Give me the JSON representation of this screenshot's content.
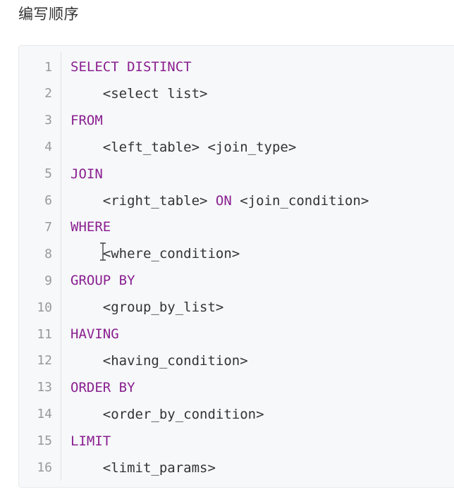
{
  "heading": "编写顺序",
  "colors": {
    "keyword": "#8a1f8f",
    "text": "#333333",
    "line_number": "#999999",
    "code_background": "#f6f8fa"
  },
  "lines": [
    {
      "n": "1",
      "indent": "",
      "kw": "SELECT DISTINCT",
      "txt": ""
    },
    {
      "n": "2",
      "indent": "    ",
      "kw": "",
      "txt": "<select list>"
    },
    {
      "n": "3",
      "indent": "",
      "kw": "FROM",
      "txt": ""
    },
    {
      "n": "4",
      "indent": "    ",
      "kw": "",
      "txt": "<left_table> <join_type>"
    },
    {
      "n": "5",
      "indent": "",
      "kw": "JOIN",
      "txt": ""
    },
    {
      "n": "6",
      "indent": "    ",
      "kw": "",
      "txt": "<right_table> ",
      "kw2": "ON",
      "txt2": " <join_condition>"
    },
    {
      "n": "7",
      "indent": "",
      "kw": "WHERE",
      "txt": ""
    },
    {
      "n": "8",
      "indent": "    ",
      "kw": "",
      "txt": "<where_condition>"
    },
    {
      "n": "9",
      "indent": "",
      "kw": "GROUP BY",
      "txt": ""
    },
    {
      "n": "10",
      "indent": "    ",
      "kw": "",
      "txt": "<group_by_list>"
    },
    {
      "n": "11",
      "indent": "",
      "kw": "HAVING",
      "txt": ""
    },
    {
      "n": "12",
      "indent": "    ",
      "kw": "",
      "txt": "<having_condition>"
    },
    {
      "n": "13",
      "indent": "",
      "kw": "ORDER BY",
      "txt": ""
    },
    {
      "n": "14",
      "indent": "    ",
      "kw": "",
      "txt": "<order_by_condition>"
    },
    {
      "n": "15",
      "indent": "",
      "kw": "LIMIT",
      "txt": ""
    },
    {
      "n": "16",
      "indent": "    ",
      "kw": "",
      "txt": "<limit_params>"
    }
  ]
}
